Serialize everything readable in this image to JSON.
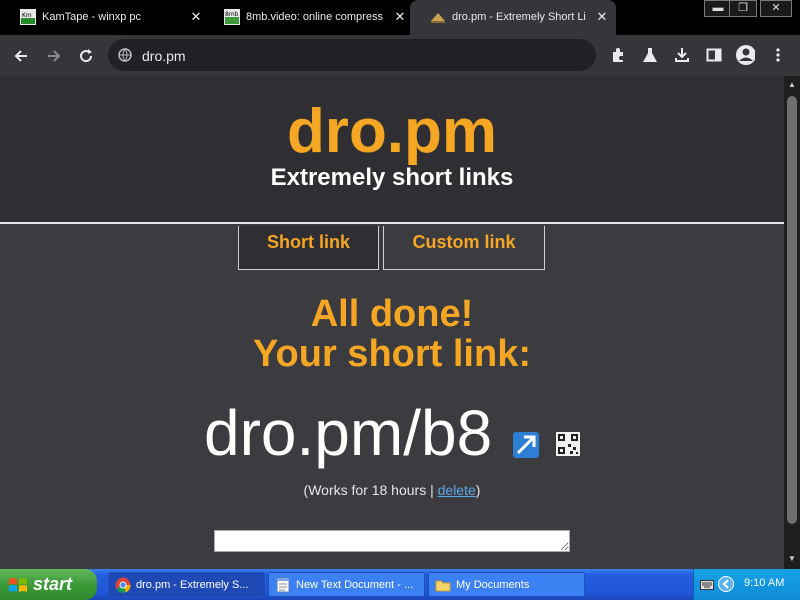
{
  "browser": {
    "tabs": [
      {
        "title": "KamTape - winxp pc",
        "favicon": "kamtape-icon",
        "active": false
      },
      {
        "title": "8mb.video: online compress",
        "favicon": "8mb-icon",
        "active": false
      },
      {
        "title": "dro.pm - Extremely Short Li",
        "favicon": "dropm-icon",
        "active": true
      }
    ],
    "address": "dro.pm"
  },
  "page": {
    "logo": "dro.pm",
    "tagline": "Extremely short links",
    "tabs": [
      "Short link",
      "Custom link"
    ],
    "done_line1": "All done!",
    "done_line2": "Your short link:",
    "short_link": "dro.pm/b8",
    "works_prefix": "(Works for 18 hours | ",
    "delete_link": "delete",
    "works_suffix": ")",
    "text_value": ""
  },
  "taskbar": {
    "start": "start",
    "tasks": [
      {
        "title": "dro.pm - Extremely S...",
        "icon": "chrome-icon"
      },
      {
        "title": "New Text Document - ...",
        "icon": "notepad-icon"
      },
      {
        "title": "My Documents",
        "icon": "folder-icon"
      }
    ],
    "clock": "9:10 AM"
  },
  "colors": {
    "accent": "#f5a623",
    "page_bg": "#3b3b40",
    "header_bg": "#2f2f33",
    "link": "#5aa9e6"
  }
}
